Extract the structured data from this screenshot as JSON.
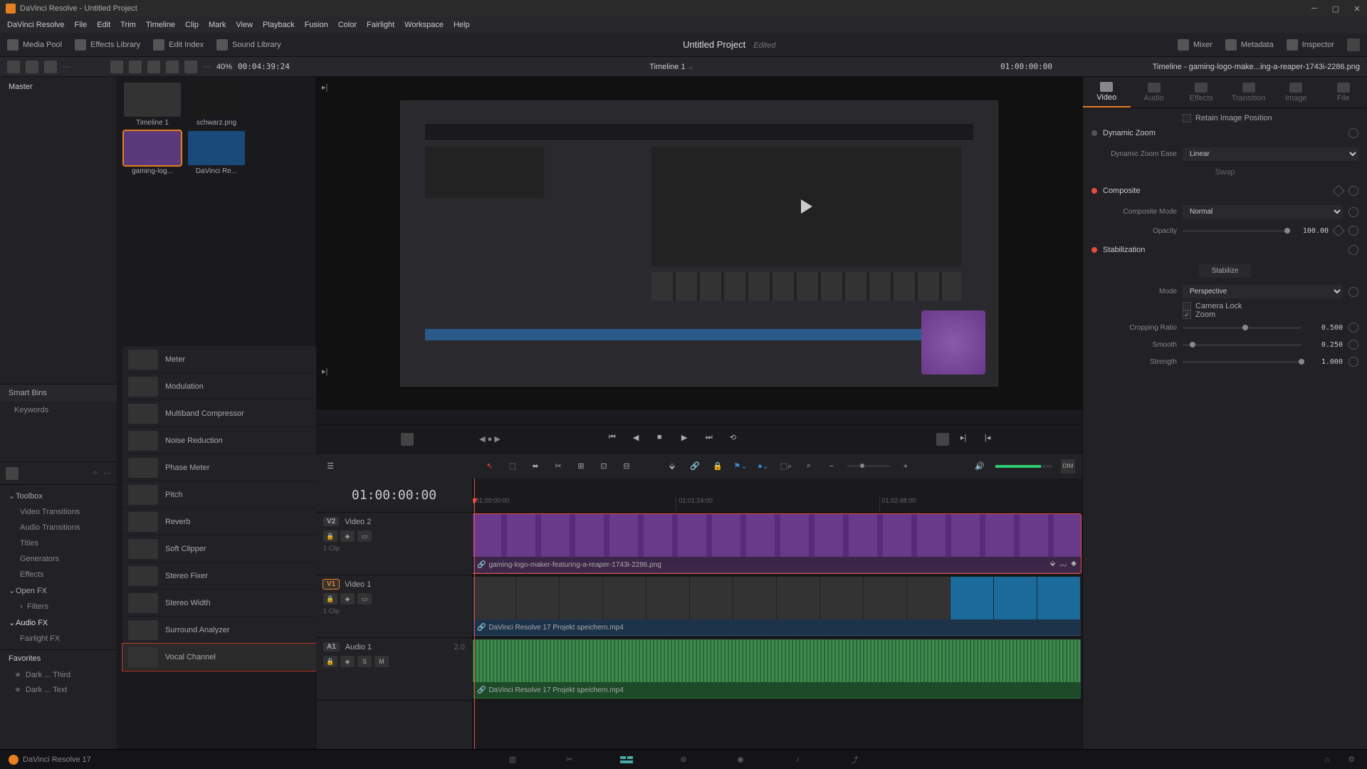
{
  "window": {
    "title": "DaVinci Resolve - Untitled Project"
  },
  "menubar": [
    "DaVinci Resolve",
    "File",
    "Edit",
    "Trim",
    "Timeline",
    "Clip",
    "Mark",
    "View",
    "Playback",
    "Fusion",
    "Color",
    "Fairlight",
    "Workspace",
    "Help"
  ],
  "toolbar": {
    "left": [
      {
        "id": "media-pool",
        "label": "Media Pool"
      },
      {
        "id": "effects-library",
        "label": "Effects Library"
      },
      {
        "id": "edit-index",
        "label": "Edit Index"
      },
      {
        "id": "sound-library",
        "label": "Sound Library"
      }
    ],
    "right": [
      {
        "id": "mixer",
        "label": "Mixer"
      },
      {
        "id": "metadata",
        "label": "Metadata"
      },
      {
        "id": "inspector",
        "label": "Inspector"
      }
    ],
    "project": "Untitled Project",
    "status": "Edited"
  },
  "subbar": {
    "zoom": "40%",
    "tc_left": "00:04:39:24",
    "timeline_name": "Timeline 1",
    "tc_right": "01:00:00:00",
    "clip_title": "Timeline - gaming-logo-make...ing-a-reaper-1743i-2286.png"
  },
  "master": "Master",
  "media": [
    {
      "name": "Timeline 1"
    },
    {
      "name": "schwarz.png"
    },
    {
      "name": "gaming-log...",
      "selected": true
    },
    {
      "name": "DaVinci Re..."
    }
  ],
  "smart_bins": "Smart Bins",
  "keywords": "Keywords",
  "fx_categories": [
    {
      "label": "Toolbox",
      "expanded": true,
      "sub": [
        "Video Transitions",
        "Audio Transitions",
        "Titles",
        "Generators",
        "Effects"
      ]
    },
    {
      "label": "Open FX",
      "expanded": true,
      "sub": [
        "Filters"
      ]
    },
    {
      "label": "Audio FX",
      "expanded": true,
      "sub": [
        "Fairlight FX"
      ]
    }
  ],
  "favorites": "Favorites",
  "fav_items": [
    "Dark ... Third",
    "Dark ... Text"
  ],
  "fx_list": [
    "Meter",
    "Modulation",
    "Multiband Compressor",
    "Noise Reduction",
    "Phase Meter",
    "Pitch",
    "Reverb",
    "Soft Clipper",
    "Stereo Fixer",
    "Stereo Width",
    "Surround Analyzer",
    "Vocal Channel"
  ],
  "inspector": {
    "tabs": [
      "Video",
      "Audio",
      "Effects",
      "Transition",
      "Image",
      "File"
    ],
    "retain_image": "Retain Image Position",
    "dynamic_zoom": {
      "title": "Dynamic Zoom",
      "ease_label": "Dynamic Zoom Ease",
      "ease_value": "Linear",
      "swap": "Swap"
    },
    "composite": {
      "title": "Composite",
      "mode_label": "Composite Mode",
      "mode_value": "Normal",
      "opacity_label": "Opacity",
      "opacity_value": "100.00"
    },
    "stabilization": {
      "title": "Stabilization",
      "stabilize_btn": "Stabilize",
      "mode_label": "Mode",
      "mode_value": "Perspective",
      "camera_lock": "Camera Lock",
      "zoom": "Zoom",
      "cropping_label": "Cropping Ratio",
      "cropping_value": "0.500",
      "smooth_label": "Smooth",
      "smooth_value": "0.250",
      "strength_label": "Strength",
      "strength_value": "1.000"
    }
  },
  "timeline": {
    "tc": "01:00:00:00",
    "ruler": [
      "01:00:00:00",
      "01:01:24:00",
      "01:02:48:00"
    ],
    "tracks": {
      "v2": {
        "tag": "V2",
        "name": "Video 2",
        "clips": "1 Clip",
        "clip_name": "gaming-logo-maker-featuring-a-reaper-1743i-2286.png"
      },
      "v1": {
        "tag": "V1",
        "name": "Video 1",
        "clips": "1 Clip",
        "clip_name": "DaVinci Resolve 17 Projekt speichern.mp4"
      },
      "a1": {
        "tag": "A1",
        "name": "Audio 1",
        "ch": "2.0",
        "clip_name": "DaVinci Resolve 17 Projekt speichern.mp4"
      }
    }
  },
  "app_version": "DaVinci Resolve 17"
}
